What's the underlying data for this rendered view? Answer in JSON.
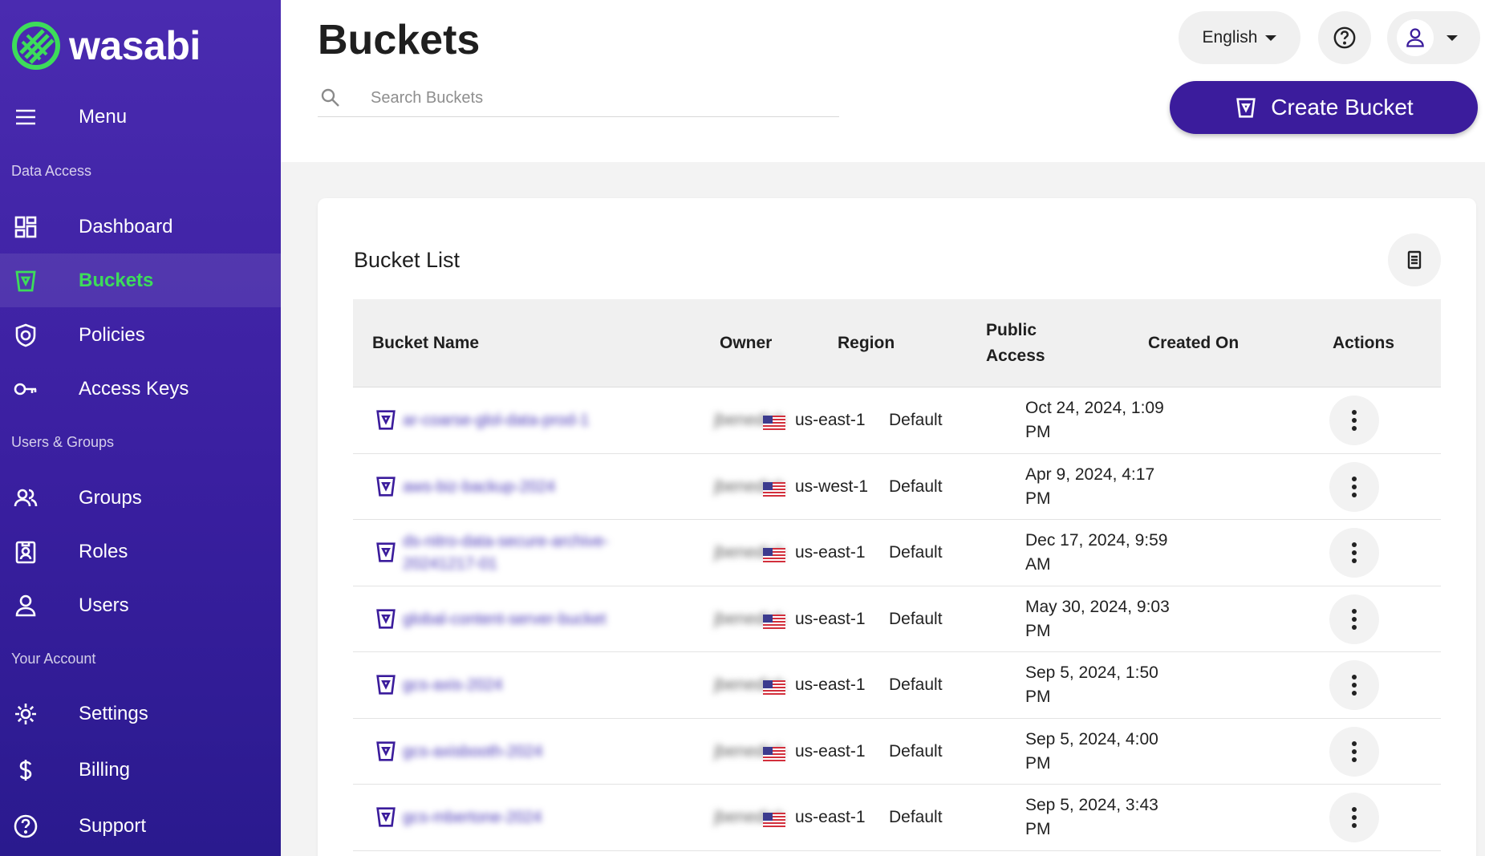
{
  "brand": {
    "name": "wasabi"
  },
  "sidebar": {
    "menu_label": "Menu",
    "sections": {
      "data_access": "Data Access",
      "users_groups": "Users & Groups",
      "your_account": "Your Account"
    },
    "items": [
      {
        "label": "Dashboard",
        "icon": "dashboard-icon"
      },
      {
        "label": "Buckets",
        "icon": "bucket-icon",
        "active": true
      },
      {
        "label": "Policies",
        "icon": "shield-icon"
      },
      {
        "label": "Access Keys",
        "icon": "key-icon"
      },
      {
        "label": "Groups",
        "icon": "groups-icon"
      },
      {
        "label": "Roles",
        "icon": "id-badge-icon"
      },
      {
        "label": "Users",
        "icon": "user-icon"
      },
      {
        "label": "Settings",
        "icon": "gear-icon"
      },
      {
        "label": "Billing",
        "icon": "dollar-icon"
      },
      {
        "label": "Support",
        "icon": "help-circle-icon"
      }
    ],
    "active_color": "#3ddc5a"
  },
  "header": {
    "title": "Buckets",
    "search_placeholder": "Search Buckets",
    "language": "English",
    "create_button": "Create Bucket"
  },
  "card": {
    "title": "Bucket List",
    "columns": [
      "Bucket Name",
      "Owner",
      "Region",
      "Public\nAccess",
      "Created On",
      "Actions"
    ],
    "rows": [
      {
        "name": "ar-coarse-glol-data-prod-1",
        "owner": "jbenedick",
        "region": "us-east-1",
        "public_access": "Default",
        "created": "Oct 24, 2024, 1:09 PM"
      },
      {
        "name": "aws-biz-backup-2024",
        "owner": "jbenedick",
        "region": "us-west-1",
        "public_access": "Default",
        "created": "Apr 9, 2024, 4:17 PM"
      },
      {
        "name": "ds-nitro-data-secure-archive-20241217-01",
        "owner": "jbenedick",
        "region": "us-east-1",
        "public_access": "Default",
        "created": "Dec 17, 2024, 9:59 AM"
      },
      {
        "name": "global-content-server-bucket",
        "owner": "jbenedick",
        "region": "us-east-1",
        "public_access": "Default",
        "created": "May 30, 2024, 9:03 PM"
      },
      {
        "name": "gcs-axis-2024",
        "owner": "jbenedick",
        "region": "us-east-1",
        "public_access": "Default",
        "created": "Sep 5, 2024, 1:50 PM"
      },
      {
        "name": "gcs-axisbooth-2024",
        "owner": "jbenedick",
        "region": "us-east-1",
        "public_access": "Default",
        "created": "Sep 5, 2024, 4:00 PM"
      },
      {
        "name": "gcs-mbertone-2024",
        "owner": "jbenedick",
        "region": "us-east-1",
        "public_access": "Default",
        "created": "Sep 5, 2024, 3:43 PM"
      }
    ]
  },
  "colors": {
    "sidebar": "#3a1fa0",
    "primary_button": "#3b1c9c",
    "bucket_icon": "#3b1c9c"
  }
}
